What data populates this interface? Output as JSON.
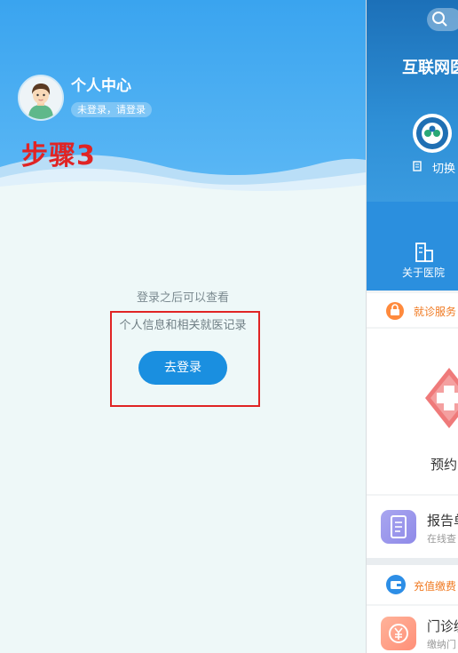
{
  "left_panel": {
    "user_title": "个人中心",
    "login_badge": "未登录，请登录",
    "step_label": "步骤3",
    "hint_line1": "登录之后可以查看",
    "hint_line2": "个人信息和相关就医记录",
    "login_button": "去登录",
    "colors": {
      "header": "#3aa4ef",
      "button": "#1a8fe0",
      "highlight": "#e02424"
    },
    "icons": {
      "avatar": "user-avatar-icon"
    }
  },
  "right_panel": {
    "hospital_title": "互联网医",
    "switch_label": "切换",
    "about_label": "关于医院",
    "section1_label": "就诊服务",
    "card_label": "预约",
    "report_title": "报告单",
    "report_sub": "在线查",
    "section2_label": "充值缴费",
    "op_title": "门诊缴",
    "op_sub": "缴纳门",
    "icons": {
      "search": "search-icon",
      "logo": "hospital-logo-icon",
      "switch": "switch-icon",
      "about": "building-icon",
      "section1": "lock-bag-icon",
      "cross": "medical-cross-icon",
      "report": "clipboard-icon",
      "section2": "wallet-icon",
      "op": "yen-coin-icon"
    }
  }
}
